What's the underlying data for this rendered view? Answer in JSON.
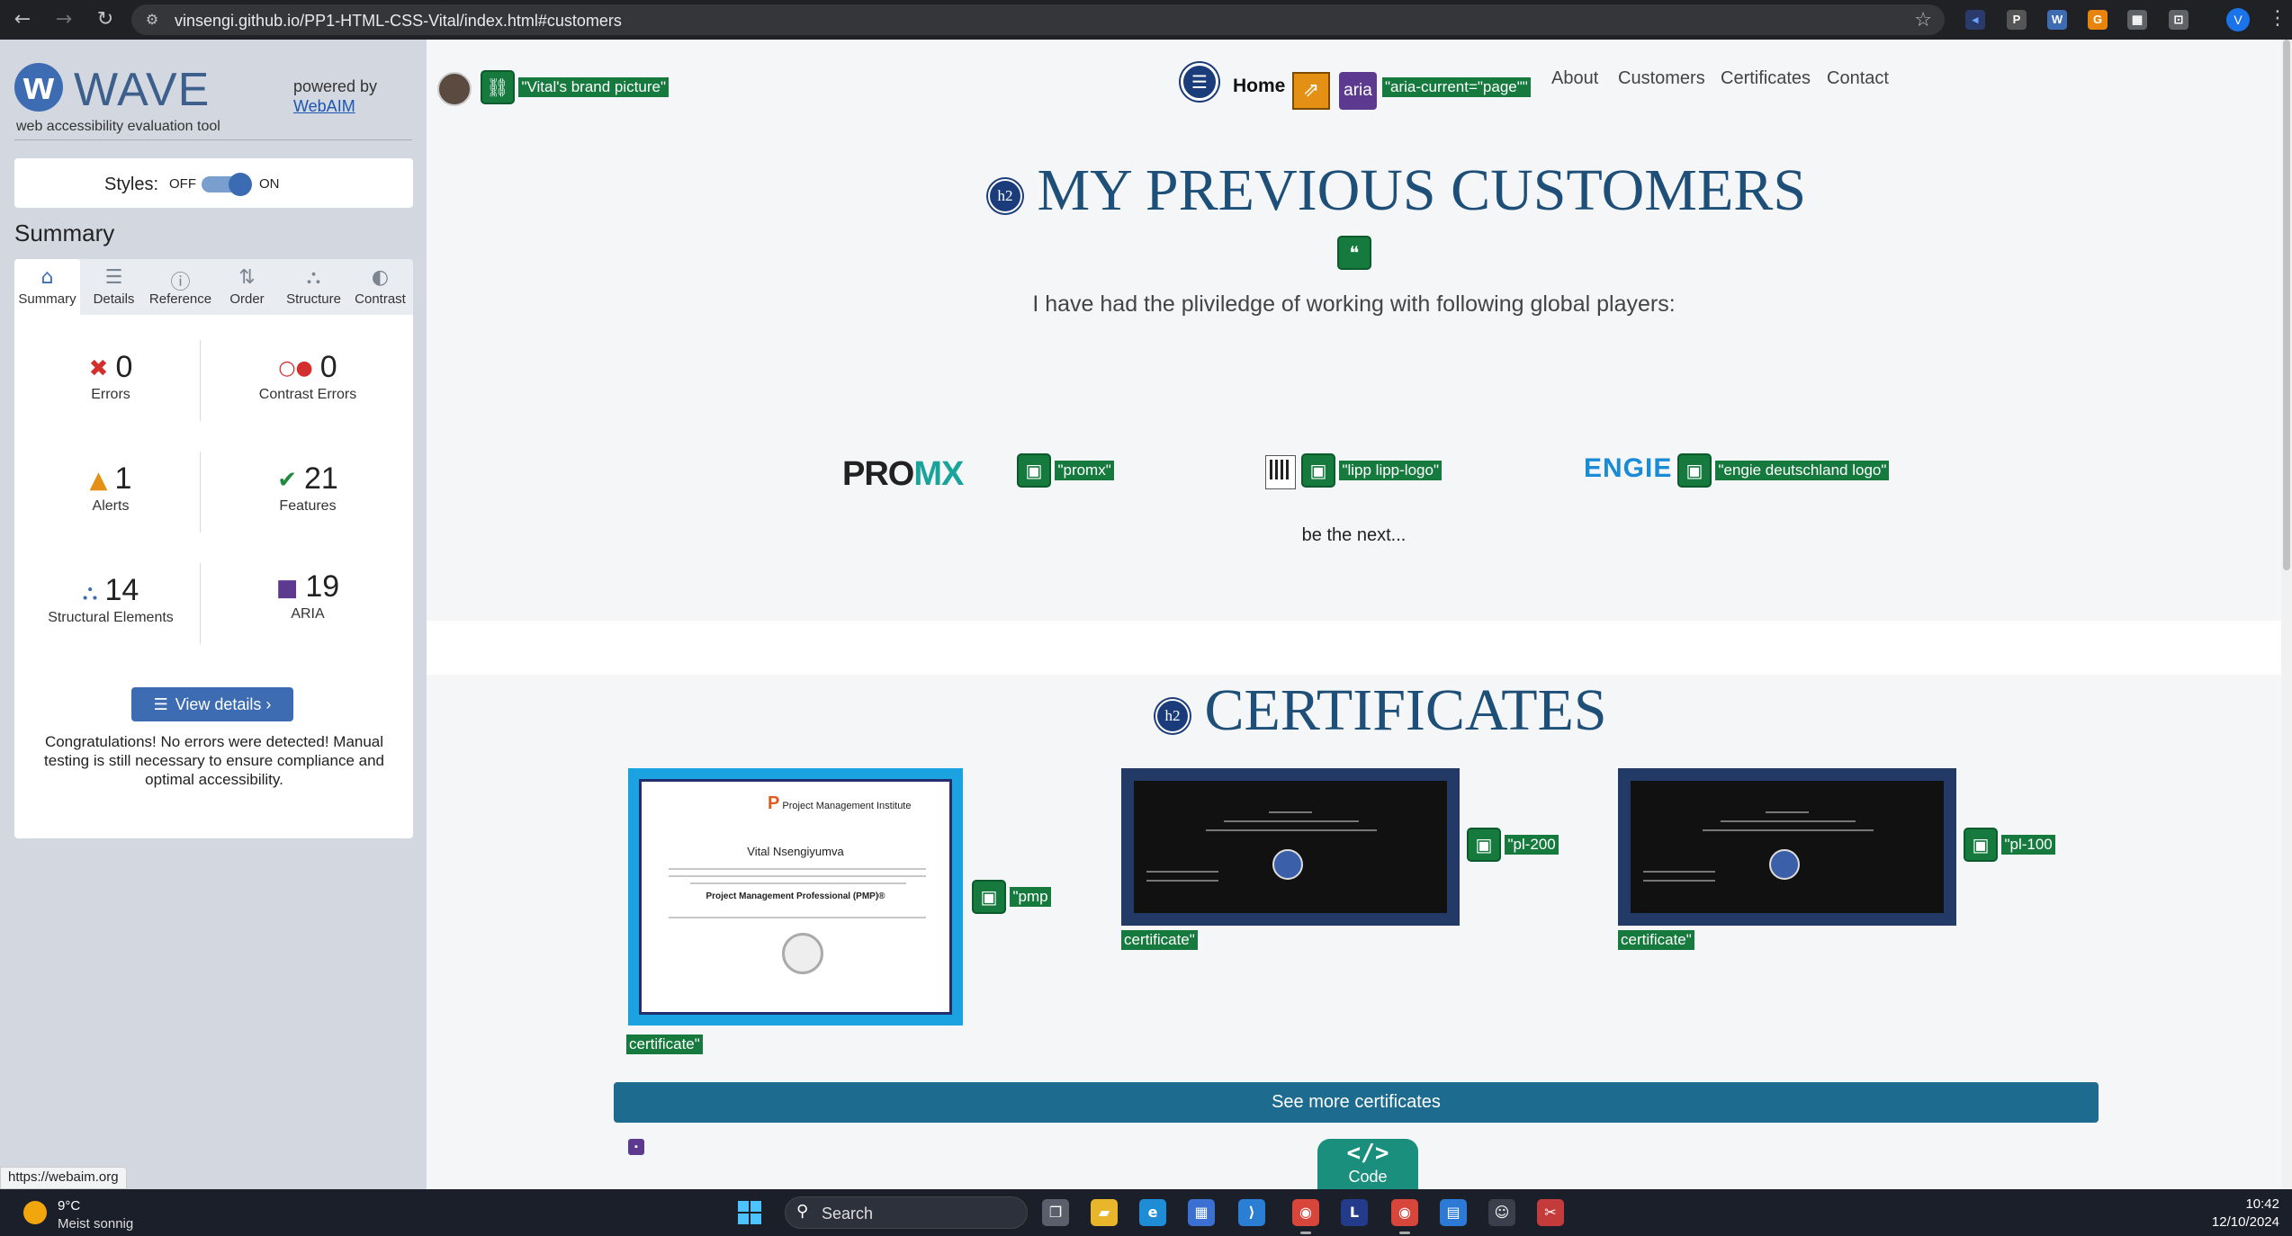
{
  "browser": {
    "url": "vinsengi.github.io/PP1-HTML-CSS-Vital/index.html#customers",
    "profile_initial": "V",
    "status_url": "https://webaim.org"
  },
  "wave": {
    "title": "WAVE",
    "tagline": "web accessibility evaluation tool",
    "powered_by": "powered by",
    "webaim": "WebAIM",
    "styles_label": "Styles:",
    "styles_off": "OFF",
    "styles_on": "ON",
    "summary_heading": "Summary",
    "tabs": [
      {
        "label": "Summary",
        "icon": "home-icon"
      },
      {
        "label": "Details",
        "icon": "list-icon"
      },
      {
        "label": "Reference",
        "icon": "info-icon"
      },
      {
        "label": "Order",
        "icon": "order-icon"
      },
      {
        "label": "Structure",
        "icon": "structure-icon"
      },
      {
        "label": "Contrast",
        "icon": "contrast-icon"
      }
    ],
    "stats": {
      "errors": {
        "count": "0",
        "label": "Errors",
        "color": "#d32f2f"
      },
      "contrast_errors": {
        "count": "0",
        "label": "Contrast Errors",
        "color": "#d32f2f"
      },
      "alerts": {
        "count": "1",
        "label": "Alerts",
        "color": "#e39014"
      },
      "features": {
        "count": "21",
        "label": "Features",
        "color": "#1e8a3d"
      },
      "structural": {
        "count": "14",
        "label": "Structural Elements",
        "color": "#3d6cb3"
      },
      "aria": {
        "count": "19",
        "label": "ARIA",
        "color": "#5b3a8f"
      }
    },
    "view_details": "View details ›",
    "congrats": "Congratulations! No errors were detected! Manual testing is still necessary to ensure compliance and optimal accessibility."
  },
  "site": {
    "brand_alt": "\"Vital's brand picture\"",
    "nav": {
      "home": "Home",
      "aria_badge": "aria",
      "aria_current": "\"aria-current=\"page\"\"",
      "links": [
        "About",
        "Customers",
        "Certificates",
        "Contact"
      ]
    },
    "customers": {
      "h2_badge": "h2",
      "heading": "MY PREVIOUS CUSTOMERS",
      "intro": "I have had the pliviledge of working with following global players:",
      "logos": [
        {
          "alt": "\"promx\"",
          "logo_text_a": "PRO",
          "logo_text_b": "MX"
        },
        {
          "alt": "\"lipp lipp-logo\""
        },
        {
          "alt": "\"engie deutschland logo\"",
          "logo_text": "ENGIE"
        }
      ],
      "outro": "be the next..."
    },
    "certificates": {
      "h2_badge": "h2",
      "heading": "CERTIFICATES",
      "pmp": {
        "alt_a": "\"pmp",
        "alt_b": "certificate\"",
        "org": "Project Management Institute",
        "holder": "Vital  Nsengiyumva",
        "title": "Project Management Professional (PMP)®"
      },
      "pl200": {
        "alt_a": "\"pl-200",
        "alt_b": "certificate\""
      },
      "pl100": {
        "alt_a": "\"pl-100",
        "alt_b": "certificate\""
      },
      "see_more": "See more certificates"
    },
    "code_button": {
      "icon": "</>",
      "label": "Code"
    }
  },
  "taskbar": {
    "temp": "9°C",
    "weather": "Meist sonnig",
    "search": "Search",
    "time": "10:42",
    "date": "12/10/2024"
  }
}
